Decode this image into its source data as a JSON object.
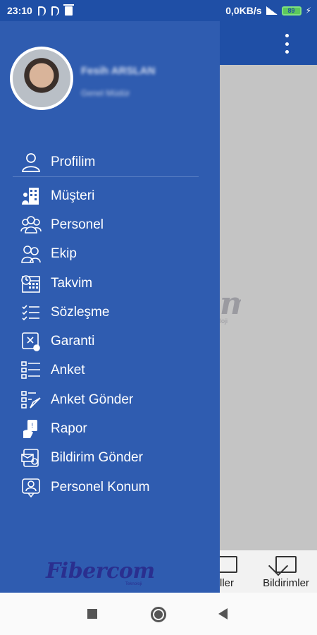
{
  "status_bar": {
    "time": "23:10",
    "network_speed": "0,0KB/s",
    "battery_level": "89",
    "icons": [
      "p-notification-icon",
      "p-notification-icon",
      "trash-icon",
      "signal-icon",
      "battery-icon",
      "charging-bolt-icon"
    ]
  },
  "drawer": {
    "user": {
      "name": "Fesih ARSLAN",
      "role": "Genel Müdür"
    },
    "menu": [
      {
        "label": "Profilim",
        "icon": "profile-icon"
      },
      {
        "label": "Müşteri",
        "icon": "customer-icon"
      },
      {
        "label": "Personel",
        "icon": "personnel-icon"
      },
      {
        "label": "Ekip",
        "icon": "team-icon"
      },
      {
        "label": "Takvim",
        "icon": "calendar-icon"
      },
      {
        "label": "Sözleşme",
        "icon": "contract-icon"
      },
      {
        "label": "Garanti",
        "icon": "warranty-icon"
      },
      {
        "label": "Anket",
        "icon": "survey-icon"
      },
      {
        "label": "Anket Gönder",
        "icon": "send-survey-icon"
      },
      {
        "label": "Rapor",
        "icon": "report-icon"
      },
      {
        "label": "Bildirim Gönder",
        "icon": "send-notification-icon"
      },
      {
        "label": "Personel Konum",
        "icon": "personnel-location-icon"
      }
    ],
    "logo": {
      "text": "Fibercom",
      "tagline": "Teknoloji"
    }
  },
  "background_app": {
    "bottom_nav": [
      {
        "label": "ller",
        "icon": "checklist-icon"
      },
      {
        "label": "Bildirimler",
        "icon": "mail-icon"
      }
    ],
    "logo_fragment": "m",
    "logo_sub_fragment": "loji"
  },
  "colors": {
    "drawer_bg": "#2f5cb0",
    "status_bar_bg": "#1f4fa6",
    "overlay_bg": "#c4c4c4",
    "logo_color": "#2a2f8f"
  }
}
